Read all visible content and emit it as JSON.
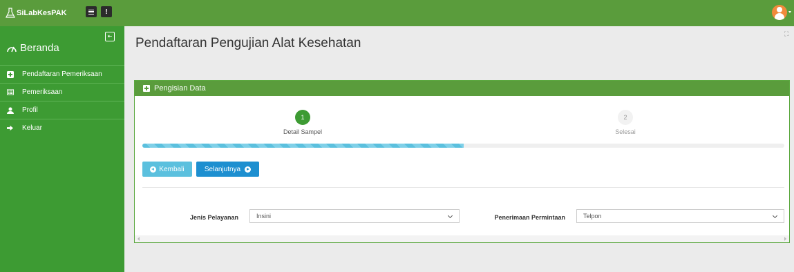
{
  "app": {
    "brand": "SiLabKesPAK",
    "info_icon": "!"
  },
  "colors": {
    "primary": "#5a9c3c",
    "sidebar": "#3d9b33",
    "info": "#5bc0de",
    "action": "#1d8fd0"
  },
  "sidebar": {
    "home_label": "Beranda",
    "home_icon": "dashboard-icon",
    "items": [
      {
        "label": "Pendaftaran Pemeriksaan",
        "icon": "plus-square-icon"
      },
      {
        "label": "Pemeriksaan",
        "icon": "list-alt-icon"
      },
      {
        "label": "Profil",
        "icon": "user-icon"
      },
      {
        "label": "Keluar",
        "icon": "sign-out-icon"
      }
    ]
  },
  "header": {
    "title": "Pendaftaran Pengujian Alat Kesehatan"
  },
  "panel": {
    "title": "Pengisian Data",
    "steps": [
      {
        "number": "1",
        "label": "Detail Sampel",
        "active": true
      },
      {
        "number": "2",
        "label": "Selesai",
        "active": false
      }
    ],
    "progress_percent": 50,
    "back_label": "Kembali",
    "next_label": "Selanjutnya",
    "form": {
      "service_label": "Jenis Pelayanan",
      "service_value": "Insini",
      "request_label": "Penerimaan Permintaan",
      "request_value": "Telpon"
    }
  }
}
